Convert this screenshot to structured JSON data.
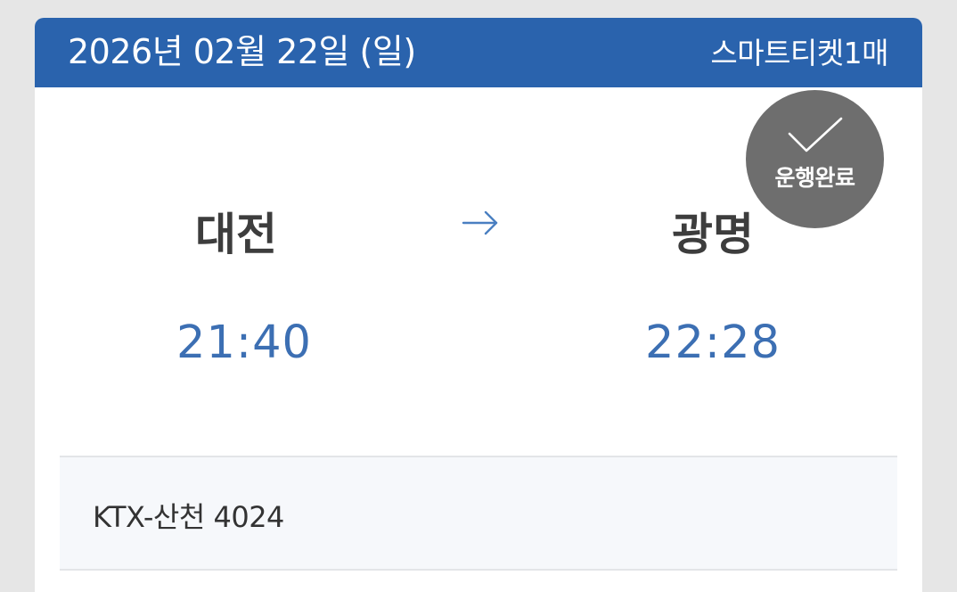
{
  "colors": {
    "header_background": "#2a63ad",
    "time_text": "#3c6fb3",
    "badge_background": "#626262",
    "page_background": "#e6e6e6"
  },
  "header": {
    "date": "2026년 02월 22일 (일)",
    "ticket_type": "스마트티켓1매"
  },
  "route": {
    "departure_station": "대전",
    "arrival_station": "광명",
    "departure_time": "21:40",
    "arrival_time": "22:28",
    "arrow_icon": "right-arrow-icon"
  },
  "status": {
    "label": "운행완료",
    "icon": "checkmark-icon"
  },
  "train": {
    "name": "KTX-산천 4024"
  }
}
